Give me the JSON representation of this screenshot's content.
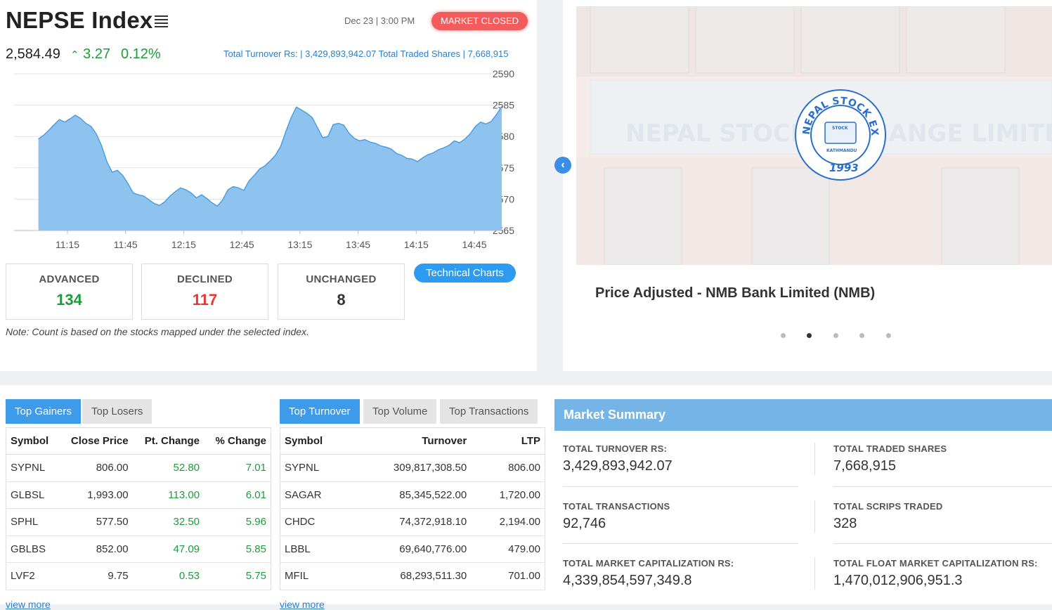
{
  "index": {
    "title": "NEPSE Index",
    "datetime": "Dec 23 | 3:00 PM",
    "market_status": "MARKET CLOSED",
    "value": "2,584.49",
    "change": "3.27",
    "pct_change": "0.12%",
    "turnover_line": "Total Turnover Rs: | 3,429,893,942.07   Total Traded Shares | 7,668,915"
  },
  "chart_data": {
    "type": "area",
    "x_ticks": [
      "11:15",
      "11:45",
      "12:15",
      "12:45",
      "13:15",
      "13:45",
      "14:15",
      "14:45"
    ],
    "y_ticks": [
      "2590",
      "2585",
      "2580",
      "2575",
      "2570",
      "2565"
    ],
    "ylim": [
      2565,
      2590
    ],
    "grid": true,
    "x": [
      "11:00",
      "11:03",
      "11:06",
      "11:09",
      "11:12",
      "11:15",
      "11:18",
      "11:21",
      "11:24",
      "11:27",
      "11:30",
      "11:33",
      "11:36",
      "11:39",
      "11:42",
      "11:45",
      "11:48",
      "11:51",
      "11:54",
      "11:57",
      "12:00",
      "12:03",
      "12:06",
      "12:09",
      "12:12",
      "12:15",
      "12:18",
      "12:21",
      "12:24",
      "12:27",
      "12:30",
      "12:33",
      "12:36",
      "12:39",
      "12:42",
      "12:45",
      "12:48",
      "12:51",
      "12:54",
      "12:57",
      "13:00",
      "13:03",
      "13:06",
      "13:09",
      "13:12",
      "13:15",
      "13:18",
      "13:21",
      "13:24",
      "13:27",
      "13:30",
      "13:33",
      "13:36",
      "13:39",
      "13:42",
      "13:45",
      "13:48",
      "13:51",
      "13:54",
      "13:57",
      "14:00",
      "14:03",
      "14:06",
      "14:09",
      "14:12",
      "14:15",
      "14:18",
      "14:21",
      "14:24",
      "14:27",
      "14:30",
      "14:33",
      "14:36",
      "14:39",
      "14:42",
      "14:45",
      "14:48",
      "14:51",
      "14:54",
      "14:57"
    ],
    "values": [
      2579.6,
      2580.2,
      2581.0,
      2581.9,
      2582.7,
      2582.3,
      2582.8,
      2583.4,
      2582.9,
      2582.1,
      2581.6,
      2580.4,
      2578.5,
      2576.0,
      2574.3,
      2574.6,
      2573.8,
      2572.5,
      2571.0,
      2570.7,
      2570.5,
      2569.9,
      2569.3,
      2569.0,
      2569.6,
      2570.5,
      2571.2,
      2571.8,
      2571.5,
      2571.0,
      2570.2,
      2570.7,
      2570.1,
      2569.4,
      2568.9,
      2569.9,
      2571.5,
      2572.0,
      2571.8,
      2571.4,
      2572.9,
      2573.8,
      2574.8,
      2575.3,
      2576.1,
      2577.0,
      2578.4,
      2580.8,
      2583.0,
      2584.7,
      2584.2,
      2583.7,
      2583.0,
      2581.4,
      2579.8,
      2580.0,
      2581.9,
      2582.1,
      2581.8,
      2580.5,
      2579.7,
      2579.3,
      2579.5,
      2579.1,
      2578.9,
      2578.5,
      2578.3,
      2578.0,
      2577.3,
      2577.0,
      2576.5,
      2576.4,
      2576.0,
      2576.6,
      2577.1,
      2577.4,
      2577.9,
      2578.2,
      2578.6,
      2579.3,
      2579.0,
      2579.6,
      2580.4,
      2581.6,
      2582.3,
      2582.0,
      2582.4,
      2583.5,
      2584.8
    ]
  },
  "stats": {
    "advanced_label": "ADVANCED",
    "advanced": "134",
    "declined_label": "DECLINED",
    "declined": "117",
    "unchanged_label": "UNCHANGED",
    "unchanged": "8",
    "tech_button": "Technical Charts",
    "note": "Note: Count is based on the stocks mapped under the selected index."
  },
  "slider": {
    "logo_ring_text": "NEPAL STOCK EXCHANGE LTD.",
    "logo_year": "1993",
    "logo_small": "STOCK",
    "logo_city": "KATHMANDU",
    "banner_text": "NEPAL STOCK EXCHANGE LIMITED",
    "caption": "Price Adjusted - NMB Bank Limited (NMB)",
    "active_dot": 2
  },
  "gainers": {
    "tabs": [
      "Top Gainers",
      "Top Losers"
    ],
    "headers": [
      "Symbol",
      "Close Price",
      "Pt. Change",
      "% Change"
    ],
    "rows": [
      [
        "SYPNL",
        "806.00",
        "52.80",
        "7.01"
      ],
      [
        "GLBSL",
        "1,993.00",
        "113.00",
        "6.01"
      ],
      [
        "SPHL",
        "577.50",
        "32.50",
        "5.96"
      ],
      [
        "GBLBS",
        "852.00",
        "47.09",
        "5.85"
      ],
      [
        "LVF2",
        "9.75",
        "0.53",
        "5.75"
      ]
    ],
    "view_more": "view more"
  },
  "turnover": {
    "tabs": [
      "Top Turnover",
      "Top Volume",
      "Top Transactions"
    ],
    "headers": [
      "Symbol",
      "Turnover",
      "LTP"
    ],
    "rows": [
      [
        "SYPNL",
        "309,817,308.50",
        "806.00"
      ],
      [
        "SAGAR",
        "85,345,522.00",
        "1,720.00"
      ],
      [
        "CHDC",
        "74,372,918.10",
        "2,194.00"
      ],
      [
        "LBBL",
        "69,640,776.00",
        "479.00"
      ],
      [
        "MFIL",
        "68,293,511.30",
        "701.00"
      ]
    ],
    "view_more": "view more"
  },
  "summary": {
    "title": "Market Summary",
    "turnover_label": "TOTAL TURNOVER RS:",
    "turnover": "3,429,893,942.07",
    "shares_label": "TOTAL TRADED SHARES",
    "shares": "7,668,915",
    "transactions_label": "TOTAL TRANSACTIONS",
    "transactions": "92,746",
    "scrips_label": "TOTAL SCRIPS TRADED",
    "scrips": "328",
    "mcap_label": "TOTAL MARKET CAPITALIZATION RS:",
    "mcap": "4,339,854,597,349.8",
    "fmcap_label": "TOTAL FLOAT MARKET CAPITALIZATION RS:",
    "fmcap": "1,470,012,906,951.3"
  },
  "colors": {
    "accent": "#3d9be9",
    "positive": "#1e9c3a",
    "negative": "#e53935",
    "closed": "#f25c5c",
    "chart_fill": "#8ec3ef"
  }
}
